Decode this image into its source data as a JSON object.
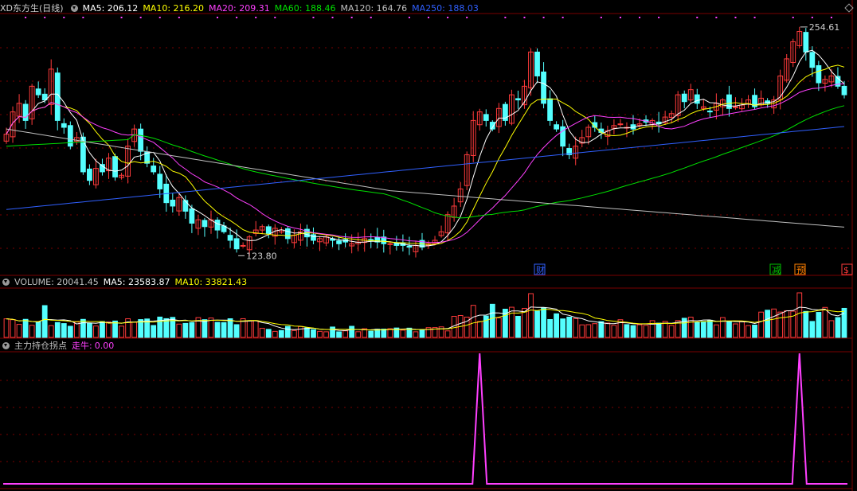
{
  "header": {
    "title": "XD东方生(日线)",
    "ma5": "MA5: 206.12",
    "ma10": "MA10: 216.20",
    "ma20": "MA20: 209.31",
    "ma60": "MA60: 188.46",
    "ma120": "MA120: 164.76",
    "ma250": "MA250: 188.03"
  },
  "volume_header": {
    "title": "VOLUME: 20041.45",
    "ma5": "MA5: 23583.87",
    "ma10": "MA10: 33821.43"
  },
  "indicator_header": {
    "title": "主力持仓拐点",
    "name": "走牛:",
    "value": "0.00"
  },
  "annotations": {
    "high": "254.61",
    "low": "123.80",
    "marks": [
      "财",
      "减",
      "预",
      "$"
    ]
  },
  "colors": {
    "up": "#ff3b3b",
    "down": "#54ffff",
    "ma5": "#ffffff",
    "ma10": "#ffff00",
    "ma20": "#ff40ff",
    "ma60": "#00e000",
    "ma120": "#c0c0c0",
    "ma250": "#3060ff",
    "indicator": "#ff40ff",
    "grid": "#7a0000"
  },
  "chart_data": [
    {
      "type": "candlestick",
      "price_range": [
        110,
        262
      ],
      "high": 254.61,
      "low": 123.8,
      "series": [
        {
          "name": "MA5",
          "value": 206.12
        },
        {
          "name": "MA10",
          "value": 216.2
        },
        {
          "name": "MA20",
          "value": 209.31
        },
        {
          "name": "MA60",
          "value": 188.46
        },
        {
          "name": "MA120",
          "value": 164.76
        },
        {
          "name": "MA250",
          "value": 188.03
        }
      ],
      "closes": [
        192,
        205,
        210,
        200,
        220,
        215,
        212,
        230,
        200,
        196,
        185,
        190,
        170,
        165,
        172,
        170,
        178,
        167,
        168,
        185,
        195,
        182,
        175,
        170,
        160,
        152,
        150,
        155,
        147,
        140,
        142,
        138,
        142,
        136,
        135,
        130,
        125,
        127,
        132,
        136,
        138,
        134,
        137,
        136,
        131,
        133,
        135,
        132,
        130,
        131,
        132,
        130,
        128,
        129,
        128,
        129,
        131,
        130,
        129,
        128,
        128,
        127,
        127,
        126,
        127,
        126,
        128,
        130,
        135,
        145,
        150,
        160,
        180,
        200,
        205,
        200,
        195,
        207,
        200,
        215,
        212,
        220,
        240,
        226,
        210,
        200,
        195,
        185,
        180,
        185,
        190,
        196,
        196,
        193,
        194,
        197,
        198,
        196,
        195,
        198,
        199,
        200,
        198,
        202,
        204,
        215,
        211,
        218,
        210,
        208,
        205,
        210,
        212,
        207,
        208,
        209,
        212,
        208,
        213,
        210,
        212,
        226,
        236,
        246,
        252,
        240,
        231,
        222,
        224,
        226,
        220,
        215
      ]
    },
    {
      "type": "bar",
      "series": [
        {
          "name": "VOLUME",
          "value": 20041.45
        },
        {
          "name": "MA5",
          "value": 23583.87
        },
        {
          "name": "MA10",
          "value": 33821.43
        }
      ]
    },
    {
      "type": "line",
      "series": [
        {
          "name": "走牛",
          "value": 0.0
        }
      ],
      "spikes_at_bar": [
        74,
        124
      ]
    }
  ]
}
